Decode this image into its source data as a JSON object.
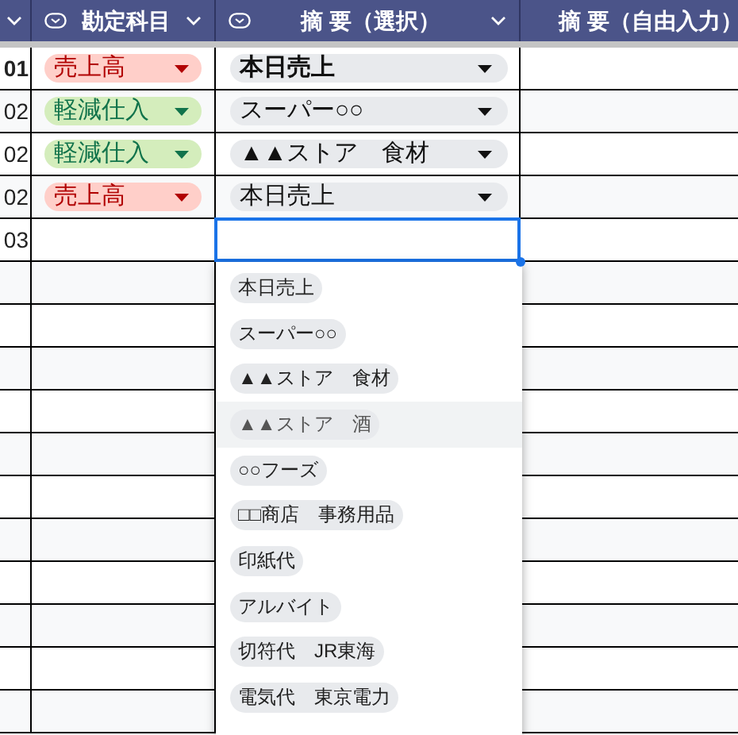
{
  "columns": [
    {
      "kind": "cut"
    },
    {
      "kind": "chip",
      "label": "勘定科目"
    },
    {
      "kind": "chip",
      "label": "摘 要（選択）"
    },
    {
      "kind": "text",
      "label": "摘 要（自由入力）"
    }
  ],
  "rows": [
    {
      "column_1": "01",
      "bold": true,
      "editing": false,
      "account": {
        "text": "売上高",
        "color": "#ffcfc9"
      },
      "summary": "本日売上"
    },
    {
      "column_1": "02",
      "bold": false,
      "editing": false,
      "account": {
        "text": "軽減仕入",
        "color": "#d4edbc"
      },
      "summary": "スーパー○○"
    },
    {
      "column_1": "02",
      "bold": false,
      "editing": false,
      "account": {
        "text": "軽減仕入",
        "color": "#d4edbc"
      },
      "summary": "▲▲ストア　食材"
    },
    {
      "column_1": "02",
      "bold": false,
      "editing": false,
      "account": {
        "text": "売上高",
        "color": "#ffcfc9"
      },
      "summary": "本日売上"
    },
    {
      "column_1": "03",
      "bold": false,
      "editing": true
    }
  ],
  "dropdown": {
    "options": [
      {
        "label": "本日売上",
        "highlighted": false
      },
      {
        "label": "スーパー○○",
        "highlighted": false
      },
      {
        "label": "▲▲ストア　食材",
        "highlighted": false
      },
      {
        "label": "▲▲ストア　酒",
        "highlighted": true
      },
      {
        "label": "○○フーズ",
        "highlighted": false
      },
      {
        "label": "□□商店　事務用品",
        "highlighted": false
      },
      {
        "label": "印紙代",
        "highlighted": false
      },
      {
        "label": "アルバイト",
        "highlighted": false
      },
      {
        "label": "切符代　JR東海",
        "highlighted": false
      },
      {
        "label": "電気代　東京電力",
        "highlighted": false
      }
    ]
  }
}
